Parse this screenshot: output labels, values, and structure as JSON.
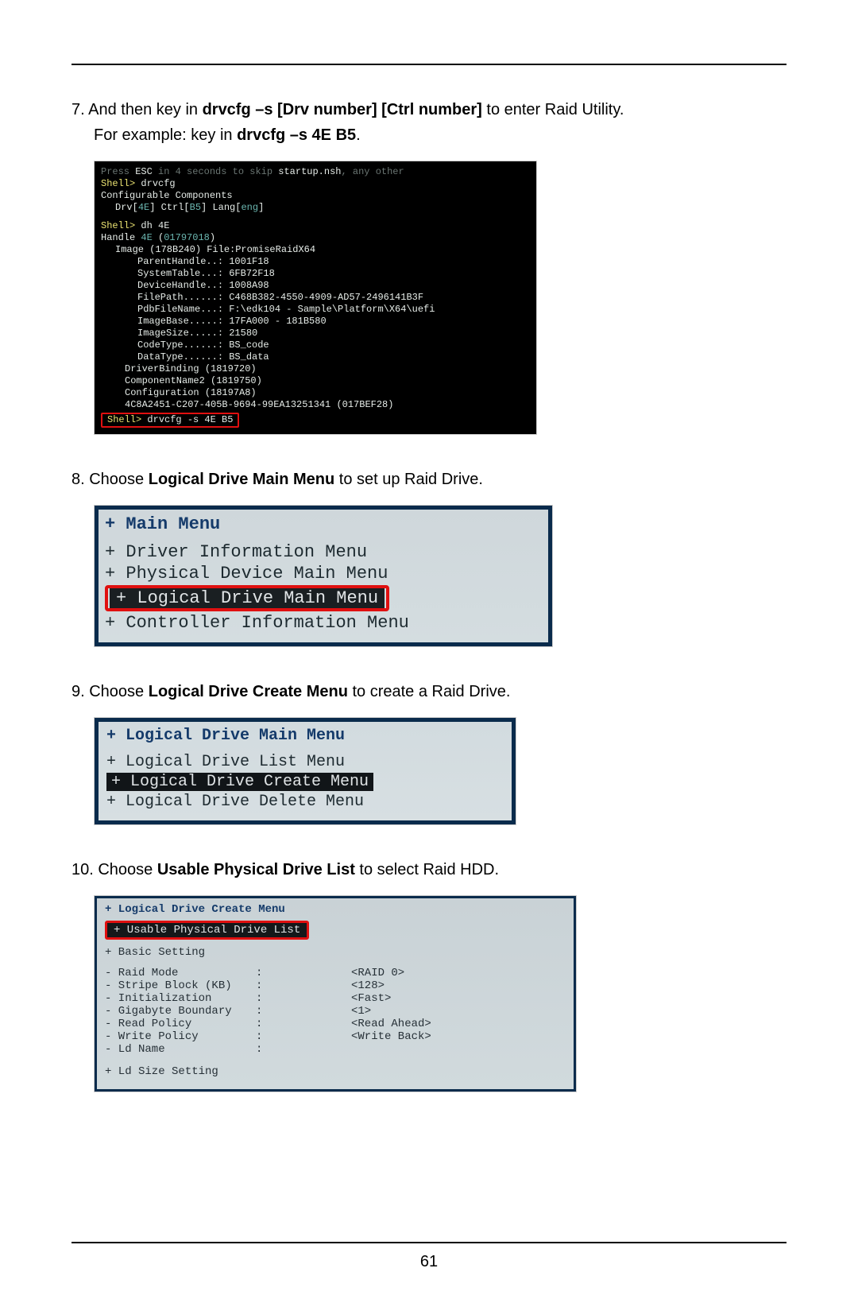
{
  "page_number": "61",
  "steps": {
    "s7_pre": "7. And then key in ",
    "s7_bold1": "drvcfg –s [Drv number] [Ctrl number]",
    "s7_post1": " to enter Raid Utility.",
    "s7_line2_pre": "For example: key in ",
    "s7_line2_bold": "drvcfg –s 4E B5",
    "s7_line2_post": ".",
    "s8_pre": "8. Choose ",
    "s8_bold": "Logical Drive Main Menu",
    "s8_post": " to set up Raid Drive.",
    "s9_pre": "9. Choose ",
    "s9_bold": "Logical Drive Create Menu",
    "s9_post": " to create a Raid Drive.",
    "s10_pre": "10. Choose ",
    "s10_bold": "Usable Physical Drive List",
    "s10_post": " to select Raid HDD."
  },
  "shell1": {
    "l0a": "Press ",
    "l0b": "ESC",
    "l0c": " in 4 seconds to skip ",
    "l0d": "startup.nsh",
    "l0e": ", any other ",
    "l1a": "Shell> ",
    "l1b": "drvcfg",
    "l2": "Configurable Components",
    "l3a": "Drv[",
    "l3b": "4E",
    "l3c": "]   Ctrl[",
    "l3d": "B5",
    "l3e": "]   Lang[",
    "l3f": "eng",
    "l3g": "]",
    "l4a": "Shell> ",
    "l4b": "dh 4E",
    "l5a": "Handle ",
    "l5b": "4E",
    "l5c": " (",
    "l5d": "01797018",
    "l5e": ")",
    "l6": "Image (178B240)    File:PromiseRaidX64",
    "l7": "ParentHandle..: 1001F18",
    "l8": "SystemTable...: 6FB72F18",
    "l9": "DeviceHandle..: 1008A98",
    "l10": "FilePath......: C468B382-4550-4909-AD57-2496141B3F",
    "l11": "PdbFileName...: F:\\edk104 - Sample\\Platform\\X64\\uefi",
    "l12": "ImageBase.....: 17FA000 - 181B580",
    "l13": "ImageSize.....: 21580",
    "l14": "CodeType......: BS_code",
    "l15": "DataType......: BS_data",
    "l16": "DriverBinding (1819720)",
    "l17": "ComponentName2 (1819750)",
    "l18": "Configuration (18197A8)",
    "l19": "4C8A2451-C207-405B-9694-99EA13251341 (017BEF28)",
    "l20a": "Shell> ",
    "l20b": "drvcfg -s 4E B5"
  },
  "menu2": {
    "title": "+ Main Menu",
    "i1": "+ Driver Information Menu",
    "i2": "+ Physical Device Main Menu",
    "i3": "+ Logical Drive Main Menu",
    "i4": "+ Controller Information Menu"
  },
  "menu3": {
    "title": "+ Logical Drive Main Menu",
    "i1": "+ Logical Drive List Menu",
    "i2": "+ Logical Drive Create Menu",
    "i3": "+ Logical Drive Delete Menu"
  },
  "menu4": {
    "title": "+ Logical Drive Create Menu",
    "hl": "+ Usable Physical Drive List",
    "basic": "+ Basic Setting",
    "rows": [
      {
        "k": "- Raid Mode",
        "v": "<RAID 0>"
      },
      {
        "k": "- Stripe Block (KB)",
        "v": "<128>"
      },
      {
        "k": "- Initialization",
        "v": "<Fast>"
      },
      {
        "k": "- Gigabyte Boundary",
        "v": "<1>"
      },
      {
        "k": "- Read Policy",
        "v": "<Read Ahead>"
      },
      {
        "k": "- Write Policy",
        "v": "<Write Back>"
      },
      {
        "k": "- Ld Name",
        "v": ""
      }
    ],
    "size": "+ Ld Size Setting",
    "colon": ":"
  }
}
